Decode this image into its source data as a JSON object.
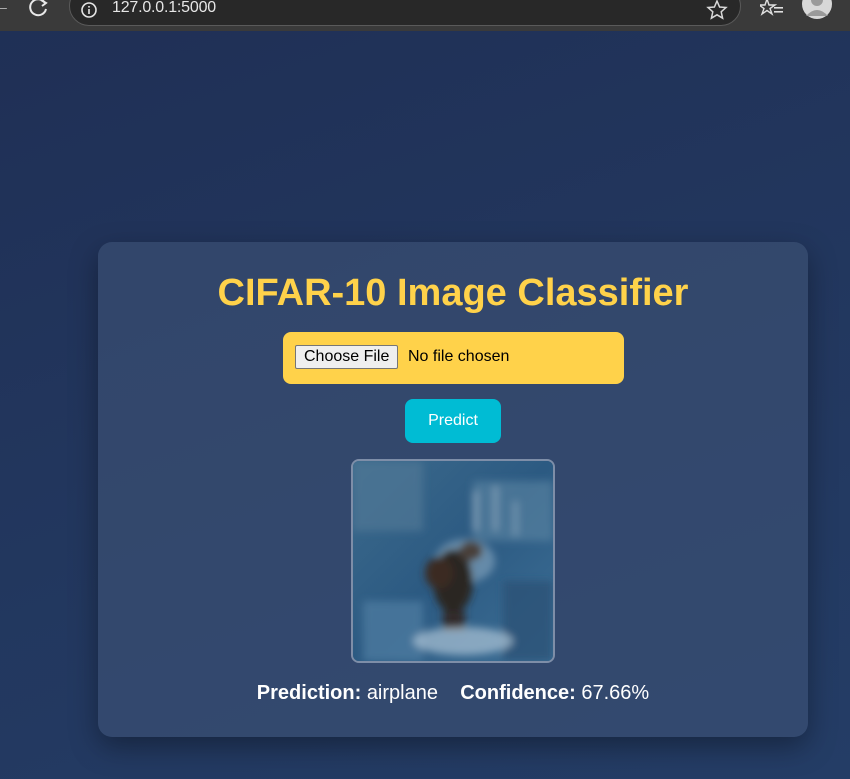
{
  "browser": {
    "url": "127.0.0.1:5000"
  },
  "app": {
    "title": "CIFAR-10 Image Classifier",
    "upload": {
      "button_label": "Choose File",
      "status": "No file chosen"
    },
    "predict_label": "Predict",
    "result": {
      "prediction_label": "Prediction:",
      "prediction_value": "airplane",
      "confidence_label": "Confidence:",
      "confidence_value": "67.66%"
    }
  },
  "colors": {
    "accent": "#ffd24a",
    "button": "#00bcd4"
  },
  "icons": [
    "back-icon",
    "reload-icon",
    "info-icon",
    "star-icon",
    "reading-list-icon",
    "profile-icon"
  ]
}
